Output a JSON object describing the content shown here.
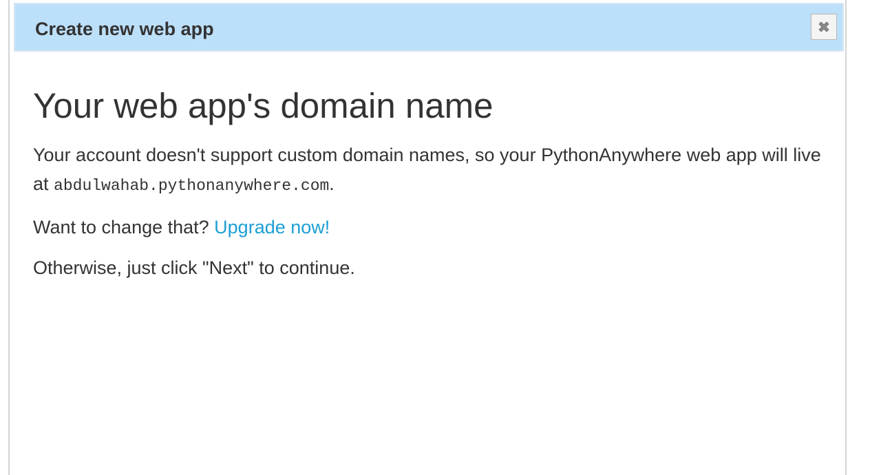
{
  "dialog": {
    "title": "Create new web app",
    "close_icon": "close-icon",
    "close_label": "✖"
  },
  "content": {
    "heading": "Your web app's domain name",
    "paragraph1_text": "Your account doesn't support custom domain names, so your PythonAnywhere web app will live at ",
    "domain": "abdulwahab.pythonanywhere.com",
    "paragraph1_end": ".",
    "paragraph2_text": "Want to change that? ",
    "upgrade_link": "Upgrade now!",
    "paragraph3_text": "Otherwise, just click \"Next\" to continue."
  },
  "colors": {
    "titlebar_bg": "#bde0fa",
    "link": "#1c9fd3",
    "text": "#333333"
  }
}
